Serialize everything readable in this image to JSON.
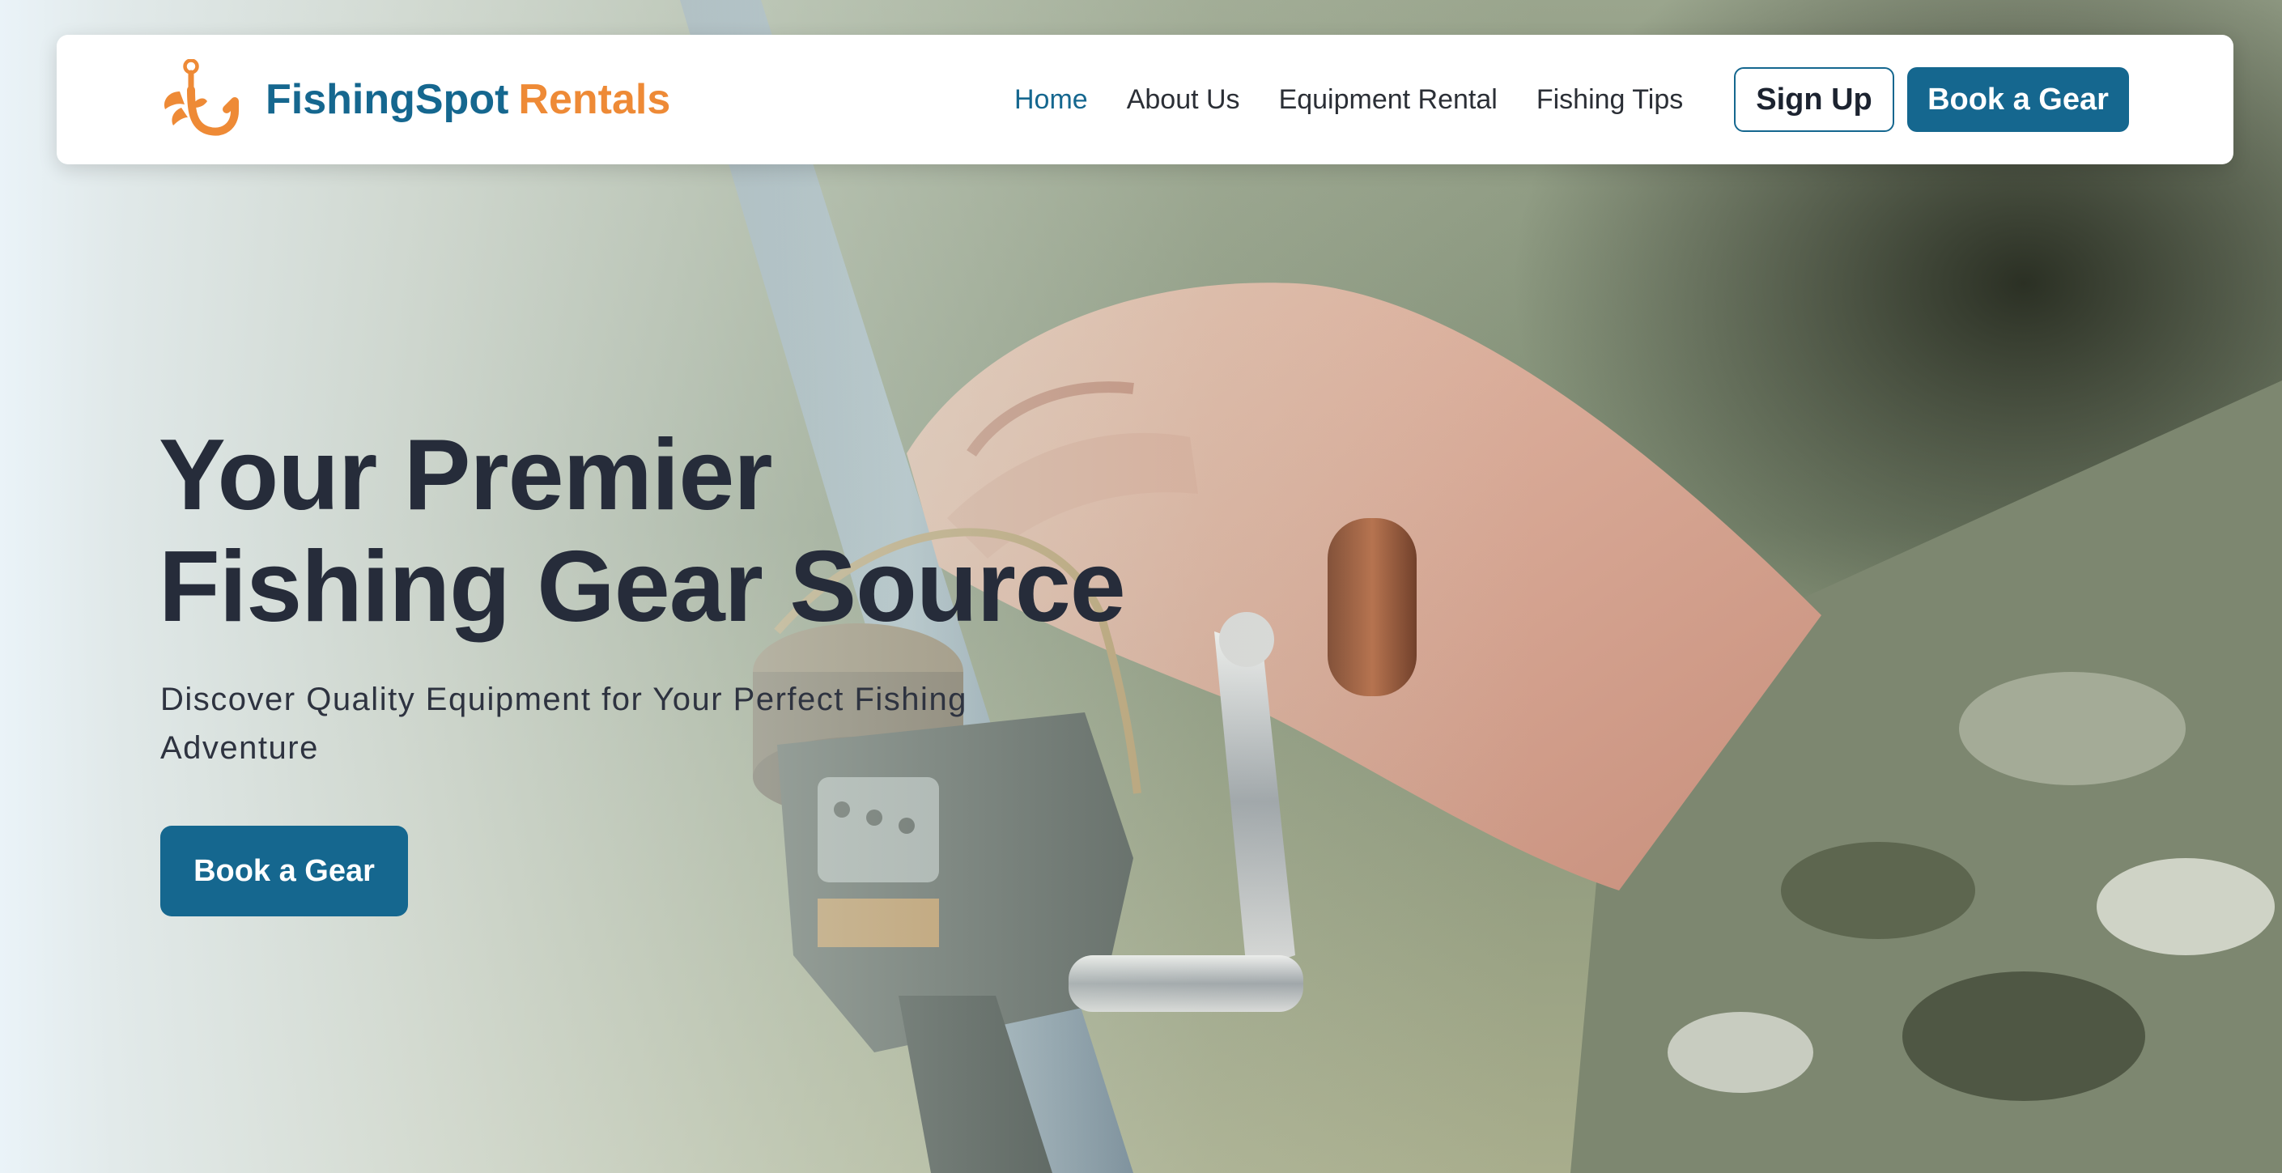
{
  "brand": {
    "name_primary": "FishingSpot",
    "name_secondary": "Rentals",
    "logo_icon": "fishing-hook-icon",
    "color_primary": "#15678f",
    "color_secondary": "#ee8a36"
  },
  "nav": {
    "items": [
      {
        "label": "Home",
        "active": true
      },
      {
        "label": "About Us",
        "active": false
      },
      {
        "label": "Equipment Rental",
        "active": false
      },
      {
        "label": "Fishing Tips",
        "active": false
      }
    ],
    "signup_label": "Sign Up",
    "book_label": "Book a Gear"
  },
  "hero": {
    "title_line1": "Your Premier",
    "title_line2": "Fishing Gear Source",
    "subtitle": "Discover Quality Equipment for Your Perfect Fishing Adventure",
    "cta_label": "Book a Gear",
    "background_image": "hand-holding-fishing-reel-photo"
  }
}
